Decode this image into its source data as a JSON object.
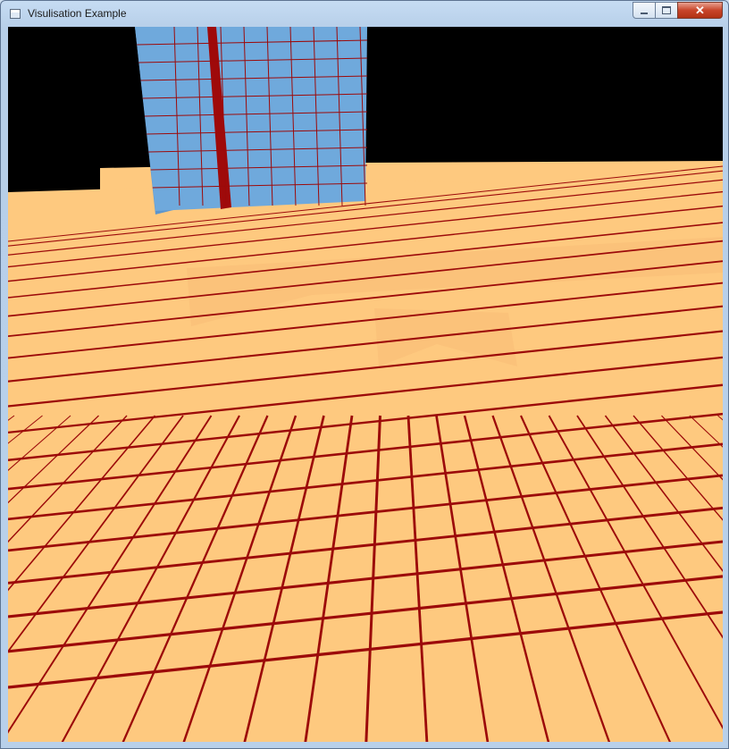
{
  "window": {
    "title": "Visulisation Example",
    "icon": "app-window-icon",
    "controls": {
      "minimize": "minimize-icon",
      "maximize": "maximize-icon",
      "close": "close-icon"
    }
  },
  "scene": {
    "background_color": "#000000",
    "floor_color": "#fec97f",
    "floor_side_color": "#fbc27a",
    "grid_color": "#9c0a0a",
    "tower_color": "#6fa9dc",
    "tower_side_color": "#5d95cc",
    "tower_stripe_color": "#9f0a0a"
  }
}
